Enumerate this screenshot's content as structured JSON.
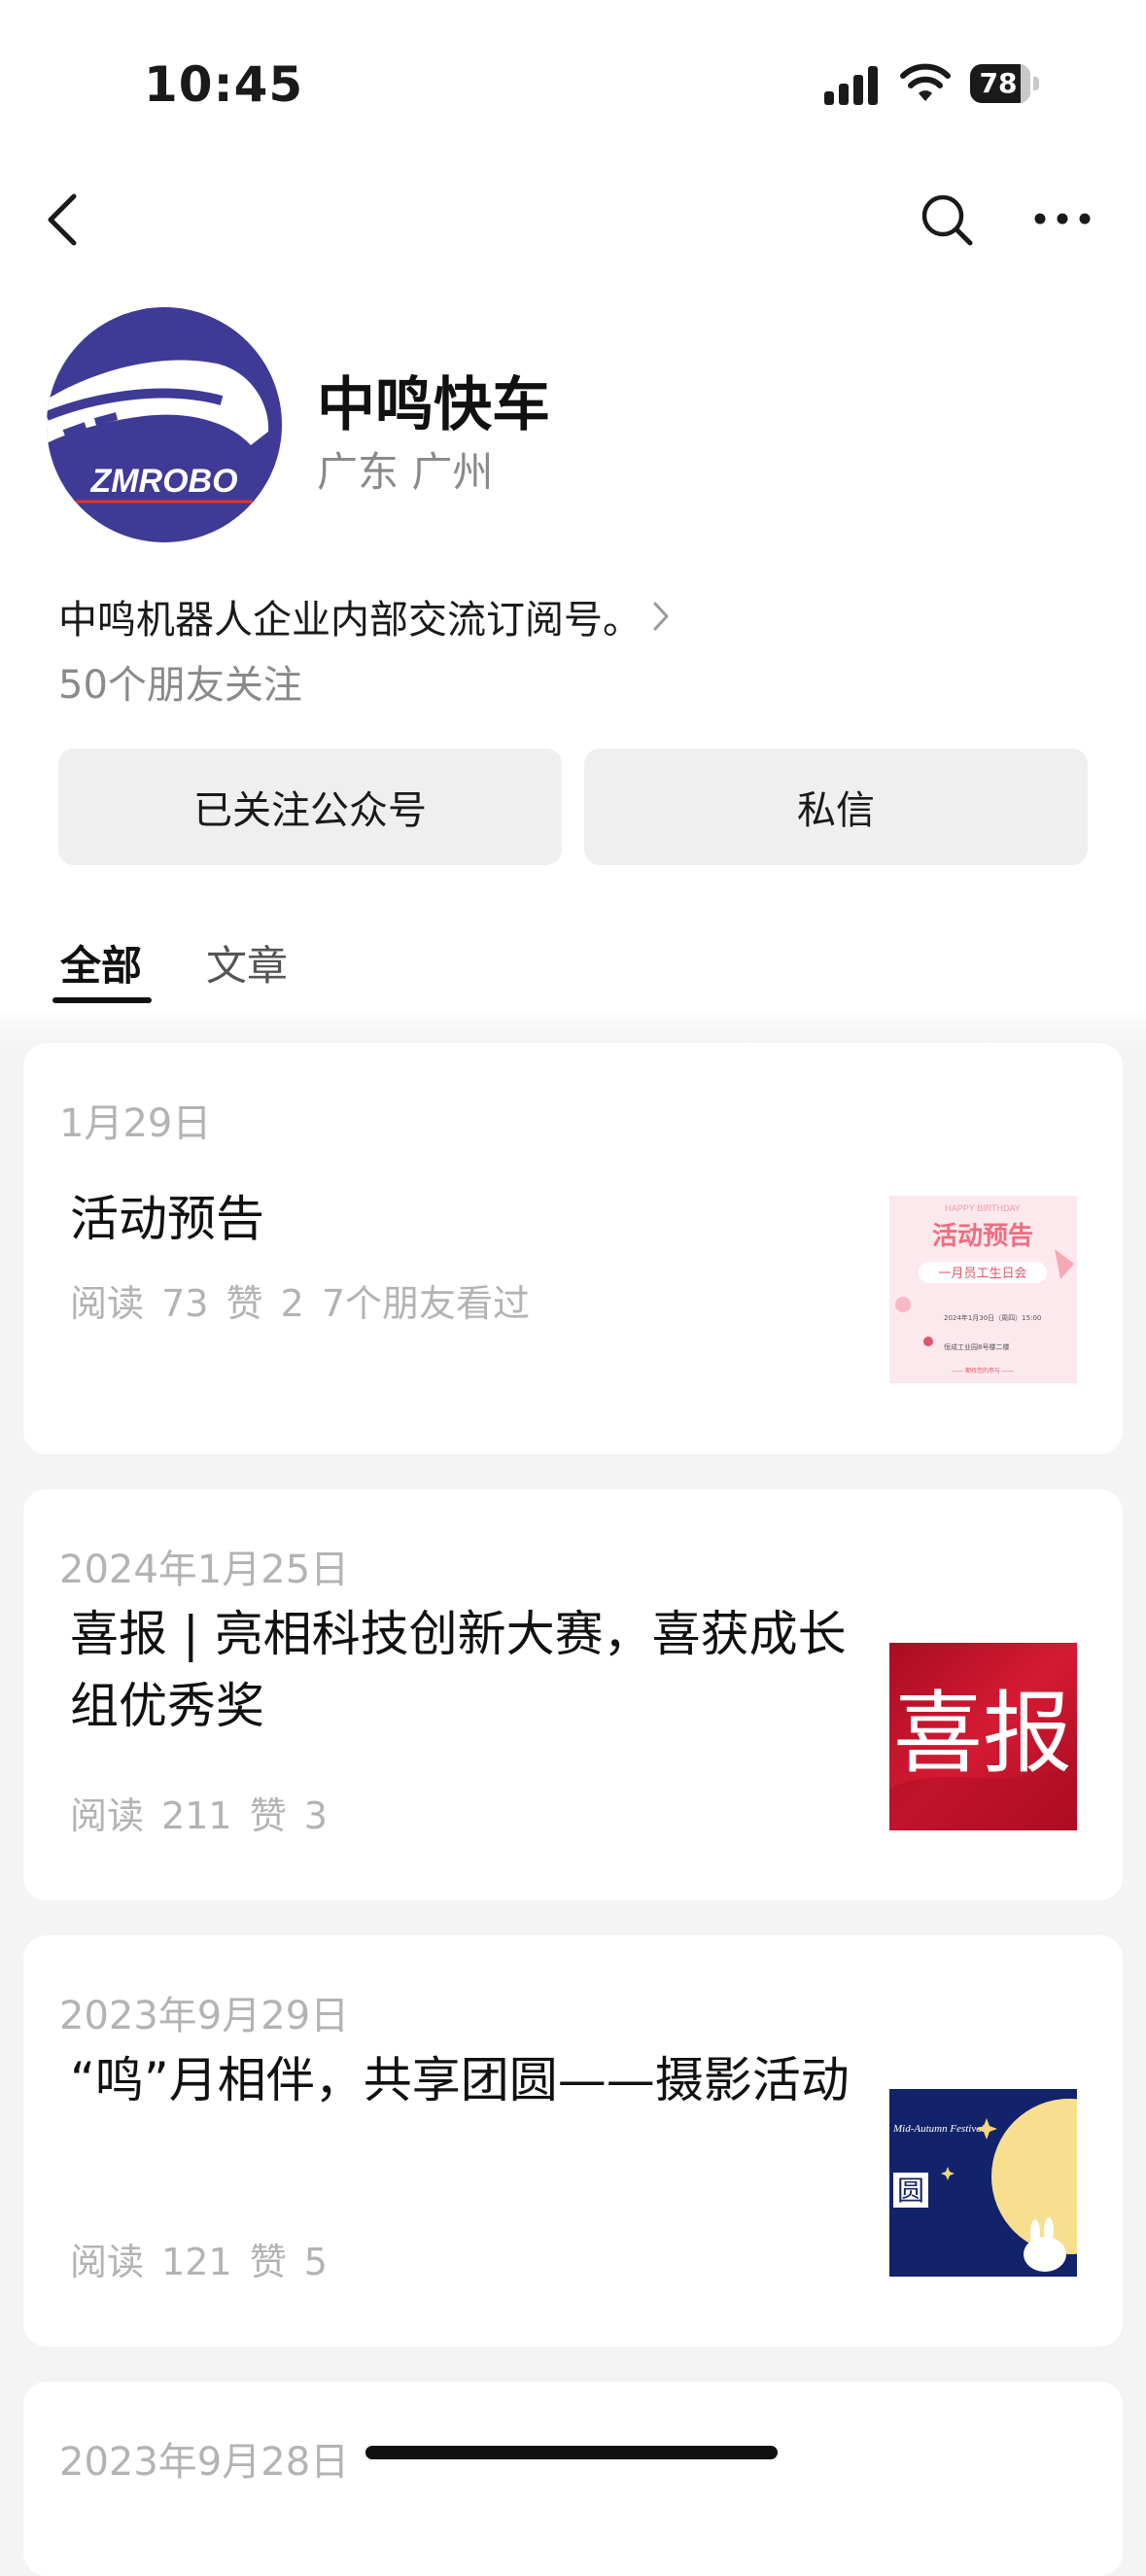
{
  "status_bar": {
    "time": "10:45",
    "battery": "78"
  },
  "account": {
    "name": "中鸣快车",
    "region": "广东 广州",
    "logo_text": "ZMROBO",
    "description": "中鸣机器人企业内部交流订阅号。",
    "followers": "50个朋友关注",
    "follow_button": "已关注公众号",
    "message_button": "私信"
  },
  "tabs": [
    "全部",
    "文章"
  ],
  "articles": [
    {
      "date": "1月29日",
      "title": "活动预告",
      "meta": "阅读 73  赞 2  7个朋友看过",
      "thumb": "poster"
    },
    {
      "date": "2024年1月25日",
      "title": "喜报 | 亮相科技创新大赛，喜获成长组优秀奖",
      "meta": "阅读 211  赞 3",
      "thumb": "red"
    },
    {
      "date": "2023年9月29日",
      "title": "“鸣”月相伴，共享团圆——摄影活动",
      "meta": "阅读 121  赞 5",
      "thumb": "moon"
    },
    {
      "date": "2023年9月28日"
    }
  ],
  "thumb_text": {
    "poster_header": "HAPPY BIRTHDAY",
    "poster_title": "活动预告",
    "poster_sub": "一月员工生日会",
    "poster_time": "2024年1月30日（周四）15:00",
    "poster_place": "恒成工业园8号楼二楼",
    "poster_footer": "—— 期待您的参与 ——",
    "red_text": "喜报",
    "moon_en": "Mid-Autumn Festival",
    "moon_cn": "圆"
  },
  "colors": {
    "brand": "#3f3a96",
    "red": "#c8102e",
    "night": "#13236b"
  }
}
